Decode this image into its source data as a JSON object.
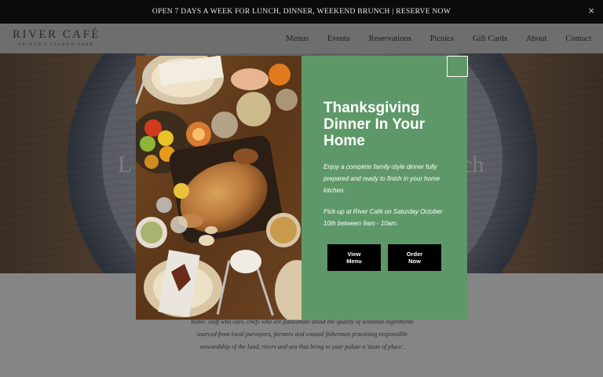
{
  "announcement": {
    "text": "OPEN 7 DAYS A WEEK FOR LUNCH, DINNER, WEEKEND BRUNCH  |  RESERVE NOW",
    "close_glyph": "×"
  },
  "brand": {
    "name": "RIVER CAFÉ",
    "tagline": "PRINCE'S ISLAND PARK"
  },
  "nav": {
    "items": [
      "Menus",
      "Events",
      "Reservations",
      "Picnics",
      "Gift Cards",
      "About",
      "Contact"
    ]
  },
  "hero": {
    "left_fragment": "L",
    "right_fragment": "ch"
  },
  "lower": {
    "lines": [
      "home: staff who care, chefs who are passionate about the quality of seasonal ingredients",
      "sourced from local purveyors, farmers and coastal fishermen practising responsible",
      "stewardship of the land, rivers and sea that bring to your palate a 'taste of place'."
    ]
  },
  "modal": {
    "title": "Thanksgiving Dinner In Your Home",
    "description": "Enjoy a complete family-style dinner fully prepared and ready to finish in your home kitchen.",
    "pickup": "Pick-up at River Café on Saturday October 10th between 9am - 10am.",
    "view_menu_label": "View\nMenu",
    "order_now_label": "Order\nNow",
    "close_icon": "close-icon",
    "panel_color": "#5e9868"
  }
}
